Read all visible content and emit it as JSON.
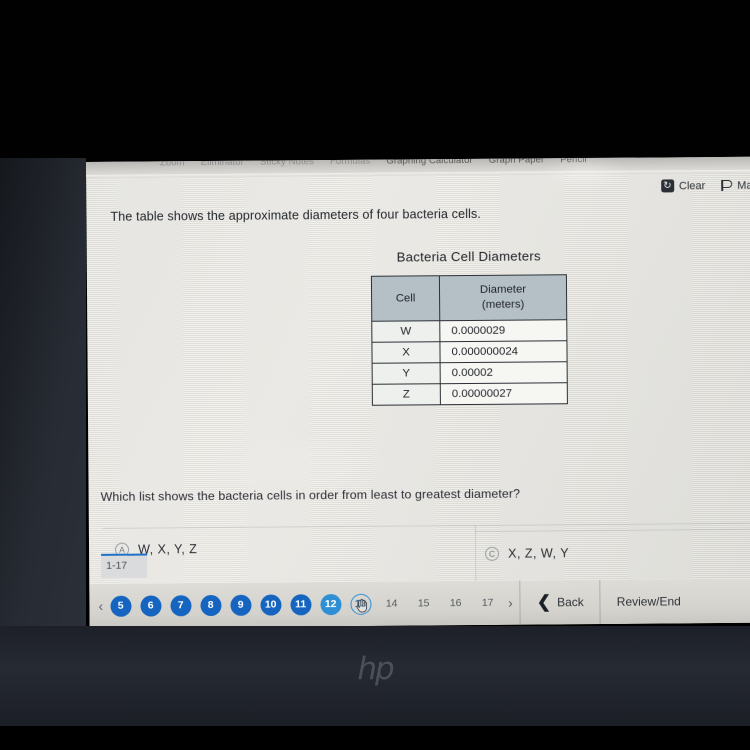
{
  "toolbar": {
    "items": [
      {
        "label": "Zoom",
        "faded": true
      },
      {
        "label": "Eliminator",
        "faded": true
      },
      {
        "label": "Sticky Notes",
        "faded": true
      },
      {
        "label": "Formulas",
        "faded": true
      },
      {
        "label": "Graphing Calculator",
        "faded": false
      },
      {
        "label": "Graph Paper",
        "faded": false
      },
      {
        "label": "Pencil",
        "faded": false
      }
    ]
  },
  "actions": {
    "clear_label": "Clear",
    "clear_icon": "reset-icon",
    "mark_label": "Mar",
    "mark_icon": "flag-icon"
  },
  "question": {
    "stem": "The table shows the approximate diameters of four bacteria cells.",
    "prompt": "Which list shows the bacteria cells in order from least to greatest diameter?"
  },
  "table": {
    "title": "Bacteria Cell Diameters",
    "headers": [
      "Cell",
      "Diameter\n(meters)"
    ],
    "header_line1": "Diameter",
    "header_line2": "(meters)",
    "rows": [
      {
        "cell": "W",
        "diameter": "0.0000029"
      },
      {
        "cell": "X",
        "diameter": "0.000000024"
      },
      {
        "cell": "Y",
        "diameter": "0.00002"
      },
      {
        "cell": "Z",
        "diameter": "0.00000027"
      }
    ]
  },
  "options": [
    {
      "letter": "A",
      "text": "W, X, Y, Z"
    },
    {
      "letter": "C",
      "text": "X, Z, W, Y"
    }
  ],
  "section_tab": {
    "label": "1-17"
  },
  "navigation": {
    "prev_arrow": "‹",
    "next_arrow": "›",
    "pages": [
      {
        "number": "5",
        "state": "answered"
      },
      {
        "number": "6",
        "state": "answered"
      },
      {
        "number": "7",
        "state": "answered"
      },
      {
        "number": "8",
        "state": "answered"
      },
      {
        "number": "9",
        "state": "answered"
      },
      {
        "number": "10",
        "state": "answered"
      },
      {
        "number": "11",
        "state": "answered"
      },
      {
        "number": "12",
        "state": "answered-light"
      },
      {
        "number": "13",
        "state": "current"
      },
      {
        "number": "14",
        "state": "plain"
      },
      {
        "number": "15",
        "state": "plain"
      },
      {
        "number": "16",
        "state": "plain"
      },
      {
        "number": "17",
        "state": "plain"
      }
    ],
    "back_label": "Back",
    "back_icon": "chevron-left-icon",
    "review_label": "Review/End"
  },
  "device": {
    "brand_logo": "hp"
  },
  "colors": {
    "page_blue": "#1565c0",
    "current_page_outline": "#2f8fd4",
    "table_header_bg": "#b4c0c6",
    "screen_bg": "#e9e7e2"
  }
}
